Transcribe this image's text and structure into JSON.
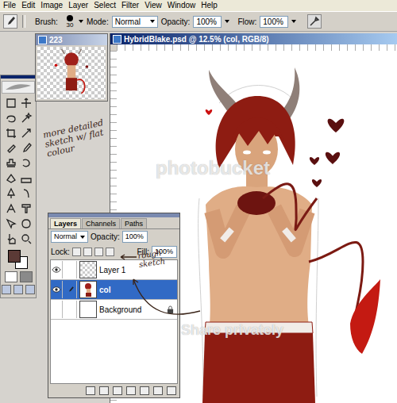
{
  "menu": [
    "File",
    "Edit",
    "Image",
    "Layer",
    "Select",
    "Filter",
    "View",
    "Window",
    "Help"
  ],
  "options_bar": {
    "brush_label": "Brush:",
    "brush_size": "30",
    "mode_label": "Mode:",
    "mode": "Normal",
    "opacity_label": "Opacity:",
    "opacity": "100%",
    "flow_label": "Flow:",
    "flow": "100%"
  },
  "thumbnail_window": {
    "title": "223"
  },
  "document": {
    "title": "HybridBlake.psd @ 12.5% (col, RGB/8)"
  },
  "annotations": [
    {
      "text": "more detailed sketch w/ flat colour"
    },
    {
      "text": "rough sketch"
    }
  ],
  "watermark": {
    "brand": "photobucket",
    "tagline": "Share privately"
  },
  "layers_panel": {
    "tabs": [
      {
        "label": "Layers",
        "selected": true
      },
      {
        "label": "Channels",
        "selected": false
      },
      {
        "label": "Paths",
        "selected": false
      }
    ],
    "blend_mode": "Normal",
    "opacity_label": "Opacity:",
    "opacity": "100%",
    "lock_label": "Lock:",
    "fill_label": "Fill:",
    "fill": "100%",
    "layers": [
      {
        "name": "Layer 1",
        "visible": true,
        "selected": false,
        "locked": false,
        "kind": "empty"
      },
      {
        "name": "col",
        "visible": true,
        "selected": true,
        "locked": false,
        "kind": "art"
      },
      {
        "name": "Background",
        "visible": false,
        "selected": false,
        "locked": true,
        "kind": "white"
      }
    ]
  }
}
